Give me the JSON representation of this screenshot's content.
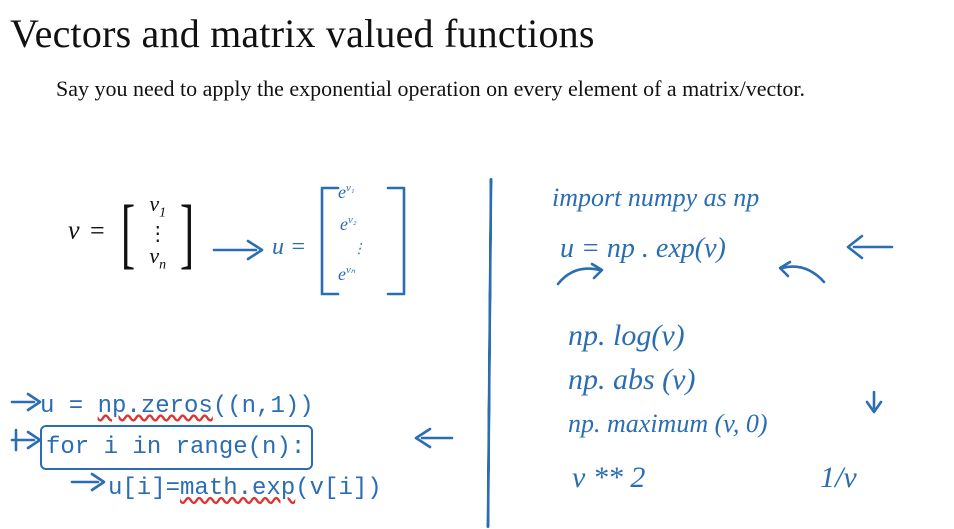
{
  "title": "Vectors and matrix valued functions",
  "intro": "Say you need to apply the exponential operation on every element of a matrix/vector.",
  "math": {
    "v_label": "v",
    "equals": "=",
    "v_top": "v",
    "v_top_sub": "1",
    "vdots": "⋮",
    "v_bot": "v",
    "v_bot_sub": "n"
  },
  "hw": {
    "u_eq": "u =",
    "e1_base": "e",
    "e1_exp": "v₁",
    "e2_base": "e",
    "e2_exp": "v₂",
    "e_dots": "⋮",
    "en_base": "e",
    "en_exp": "vₙ"
  },
  "code": {
    "l1_pre": "u = ",
    "l1_fn": "np.zeros",
    "l1_post": "((n,1))",
    "l2_pre": "for i in range(n):",
    "l3_pre": "u[i]=",
    "l3_fn": "math.exp",
    "l3_post": "(v[i])"
  },
  "right": {
    "import": "import  numpy  as  np",
    "exp": "u = np . exp(v)",
    "log": "np. log(v)",
    "abs": "np. abs (v)",
    "max": "np. maximum (v, 0)",
    "sq": "v ** 2",
    "inv": "1/v"
  }
}
